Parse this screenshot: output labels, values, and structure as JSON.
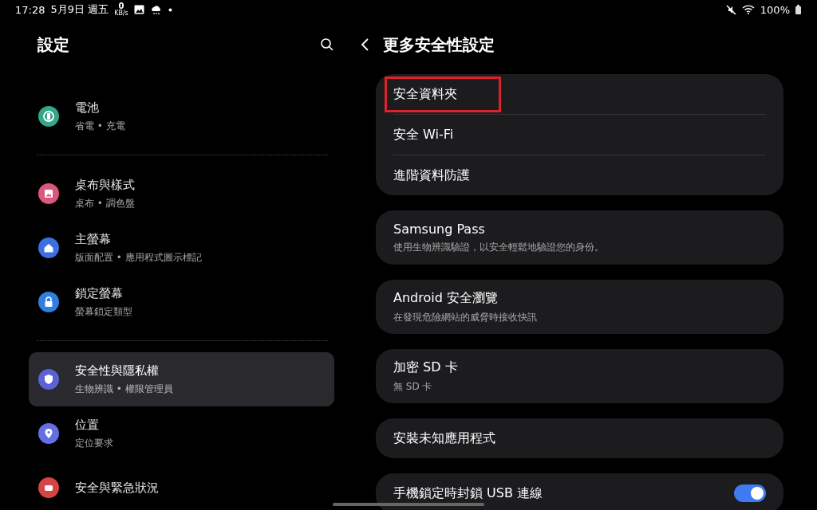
{
  "status_bar": {
    "time": "17:28",
    "date": "5月9日 週五",
    "net_speed": "0",
    "net_unit": "KB/s",
    "battery": "100%"
  },
  "left": {
    "title": "設定",
    "groups": [
      [
        {
          "kind": "battery",
          "title": "電池",
          "subtitle": "省電 • 充電",
          "color": "#35a68a",
          "selected": false
        }
      ],
      [
        {
          "kind": "wallpaper",
          "title": "桌布與樣式",
          "subtitle": "桌布 • 調色盤",
          "color": "#d9587c",
          "selected": false
        },
        {
          "kind": "home",
          "title": "主螢幕",
          "subtitle": "版面配置 • 應用程式圖示標記",
          "color": "#3c6fe0",
          "selected": false
        },
        {
          "kind": "lock",
          "title": "鎖定螢幕",
          "subtitle": "螢幕鎖定類型",
          "color": "#2f7fe2",
          "selected": false
        }
      ],
      [
        {
          "kind": "shield",
          "title": "安全性與隱私權",
          "subtitle": "生物辨識 • 權限管理員",
          "color": "#5a62d6",
          "selected": true
        },
        {
          "kind": "pin",
          "title": "位置",
          "subtitle": "定位要求",
          "color": "#6470e2",
          "selected": false
        },
        {
          "kind": "alert",
          "title": "安全與緊急狀況",
          "color": "#d64545",
          "selected": false
        }
      ]
    ]
  },
  "right": {
    "title": "更多安全性設定",
    "cards": [
      {
        "rows": [
          {
            "title": "安全資料夾",
            "highlighted": true
          },
          {
            "title": "安全 Wi-Fi",
            "highlighted": false
          },
          {
            "title": "進階資料防護",
            "highlighted": false
          }
        ]
      },
      {
        "rows": [
          {
            "title": "Samsung Pass",
            "subtitle": "使用生物辨識驗證，以安全輕鬆地驗證您的身份。",
            "highlighted": false
          }
        ]
      },
      {
        "rows": [
          {
            "title": "Android 安全瀏覽",
            "subtitle": "在發現危險網站的威脅時接收快訊",
            "highlighted": false
          }
        ]
      },
      {
        "rows": [
          {
            "title": "加密 SD 卡",
            "subtitle": "無 SD 卡",
            "highlighted": false
          }
        ]
      },
      {
        "rows": [
          {
            "title": "安裝未知應用程式",
            "highlighted": false
          }
        ]
      },
      {
        "rows": [
          {
            "title": "手機鎖定時封鎖 USB 連線",
            "highlighted": false,
            "toggle": {
              "on": true
            }
          }
        ]
      }
    ]
  }
}
